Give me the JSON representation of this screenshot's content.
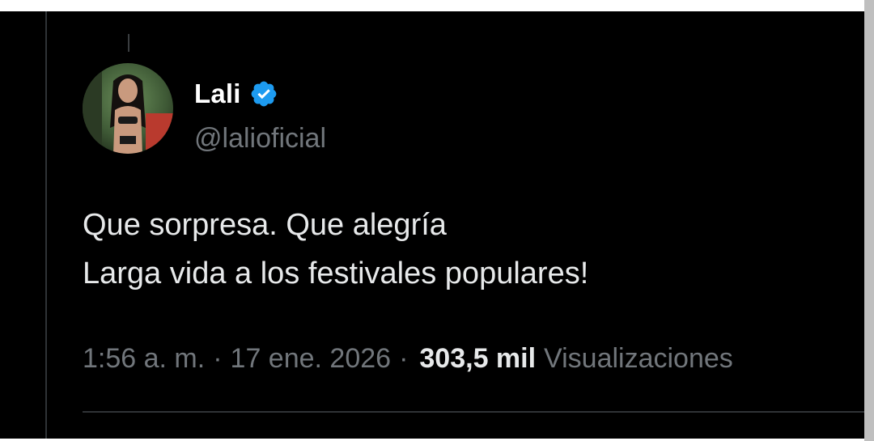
{
  "tweet": {
    "author": {
      "display_name": "Lali",
      "handle": "@lalioficial",
      "verified": true
    },
    "text_line_1": "Que sorpresa. Que alegría",
    "text_line_2": "Larga vida a los festivales populares!",
    "time": "1:56 a. m.",
    "separator": "·",
    "date": "17 ene. 2026",
    "views_count": "303,5 mil",
    "views_label": "Visualizaciones"
  },
  "colors": {
    "background": "#000000",
    "primary_text": "#e7e9ea",
    "secondary_text": "#71767b",
    "verified_badge": "#1d9bf0",
    "divider": "#2f3336"
  },
  "icons": {
    "verified": "verified-badge-icon",
    "avatar": "profile-photo"
  }
}
